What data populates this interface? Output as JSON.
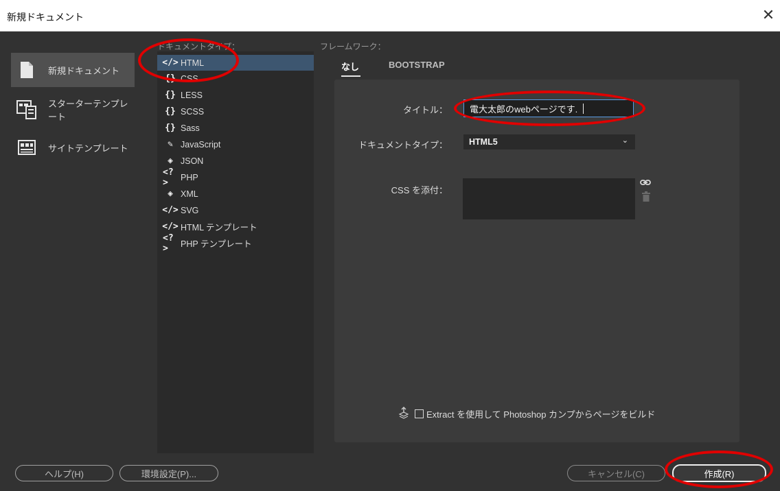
{
  "window": {
    "title": "新規ドキュメント",
    "close_glyph": "✕"
  },
  "categories": [
    {
      "label": "新規ドキュメント",
      "icon": "new-document-icon",
      "selected": true
    },
    {
      "label": "スターターテンプレート",
      "icon": "starter-template-icon",
      "selected": false
    },
    {
      "label": "サイトテンプレート",
      "icon": "site-template-icon",
      "selected": false
    }
  ],
  "doc_types": {
    "heading": "ドキュメントタイプ：",
    "items": [
      {
        "glyph": "</>",
        "label": "HTML",
        "selected": true
      },
      {
        "glyph": "{}",
        "label": "CSS"
      },
      {
        "glyph": "{}",
        "label": "LESS"
      },
      {
        "glyph": "{}",
        "label": "SCSS"
      },
      {
        "glyph": "{}",
        "label": "Sass"
      },
      {
        "glyph": "✎",
        "label": "JavaScript"
      },
      {
        "glyph": "◈",
        "label": "JSON"
      },
      {
        "glyph": "<?>",
        "label": "PHP"
      },
      {
        "glyph": "◈",
        "label": "XML"
      },
      {
        "glyph": "</>",
        "label": "SVG"
      },
      {
        "glyph": "</>",
        "label": "HTML テンプレート"
      },
      {
        "glyph": "<?>",
        "label": "PHP テンプレート"
      }
    ]
  },
  "framework": {
    "heading": "フレームワーク：",
    "tabs": [
      {
        "label": "なし",
        "active": true
      },
      {
        "label": "BOOTSTRAP",
        "active": false
      }
    ]
  },
  "form": {
    "title_label": "タイトル：",
    "title_value": "電大太郎のwebページです.",
    "doctype_label": "ドキュメントタイプ：",
    "doctype_value": "HTML5",
    "css_label": "CSS を添付：",
    "extract_text": "Extract を使用して Photoshop カンプからページをビルド"
  },
  "buttons": {
    "help": "ヘルプ(H)",
    "preferences": "環境設定(P)...",
    "cancel": "キャンセル(C)",
    "create": "作成(R)"
  },
  "colors": {
    "background": "#323232",
    "selected_doctype": "#3d5670",
    "input_focus": "#5a9ee6",
    "annotation": "#e00000"
  }
}
